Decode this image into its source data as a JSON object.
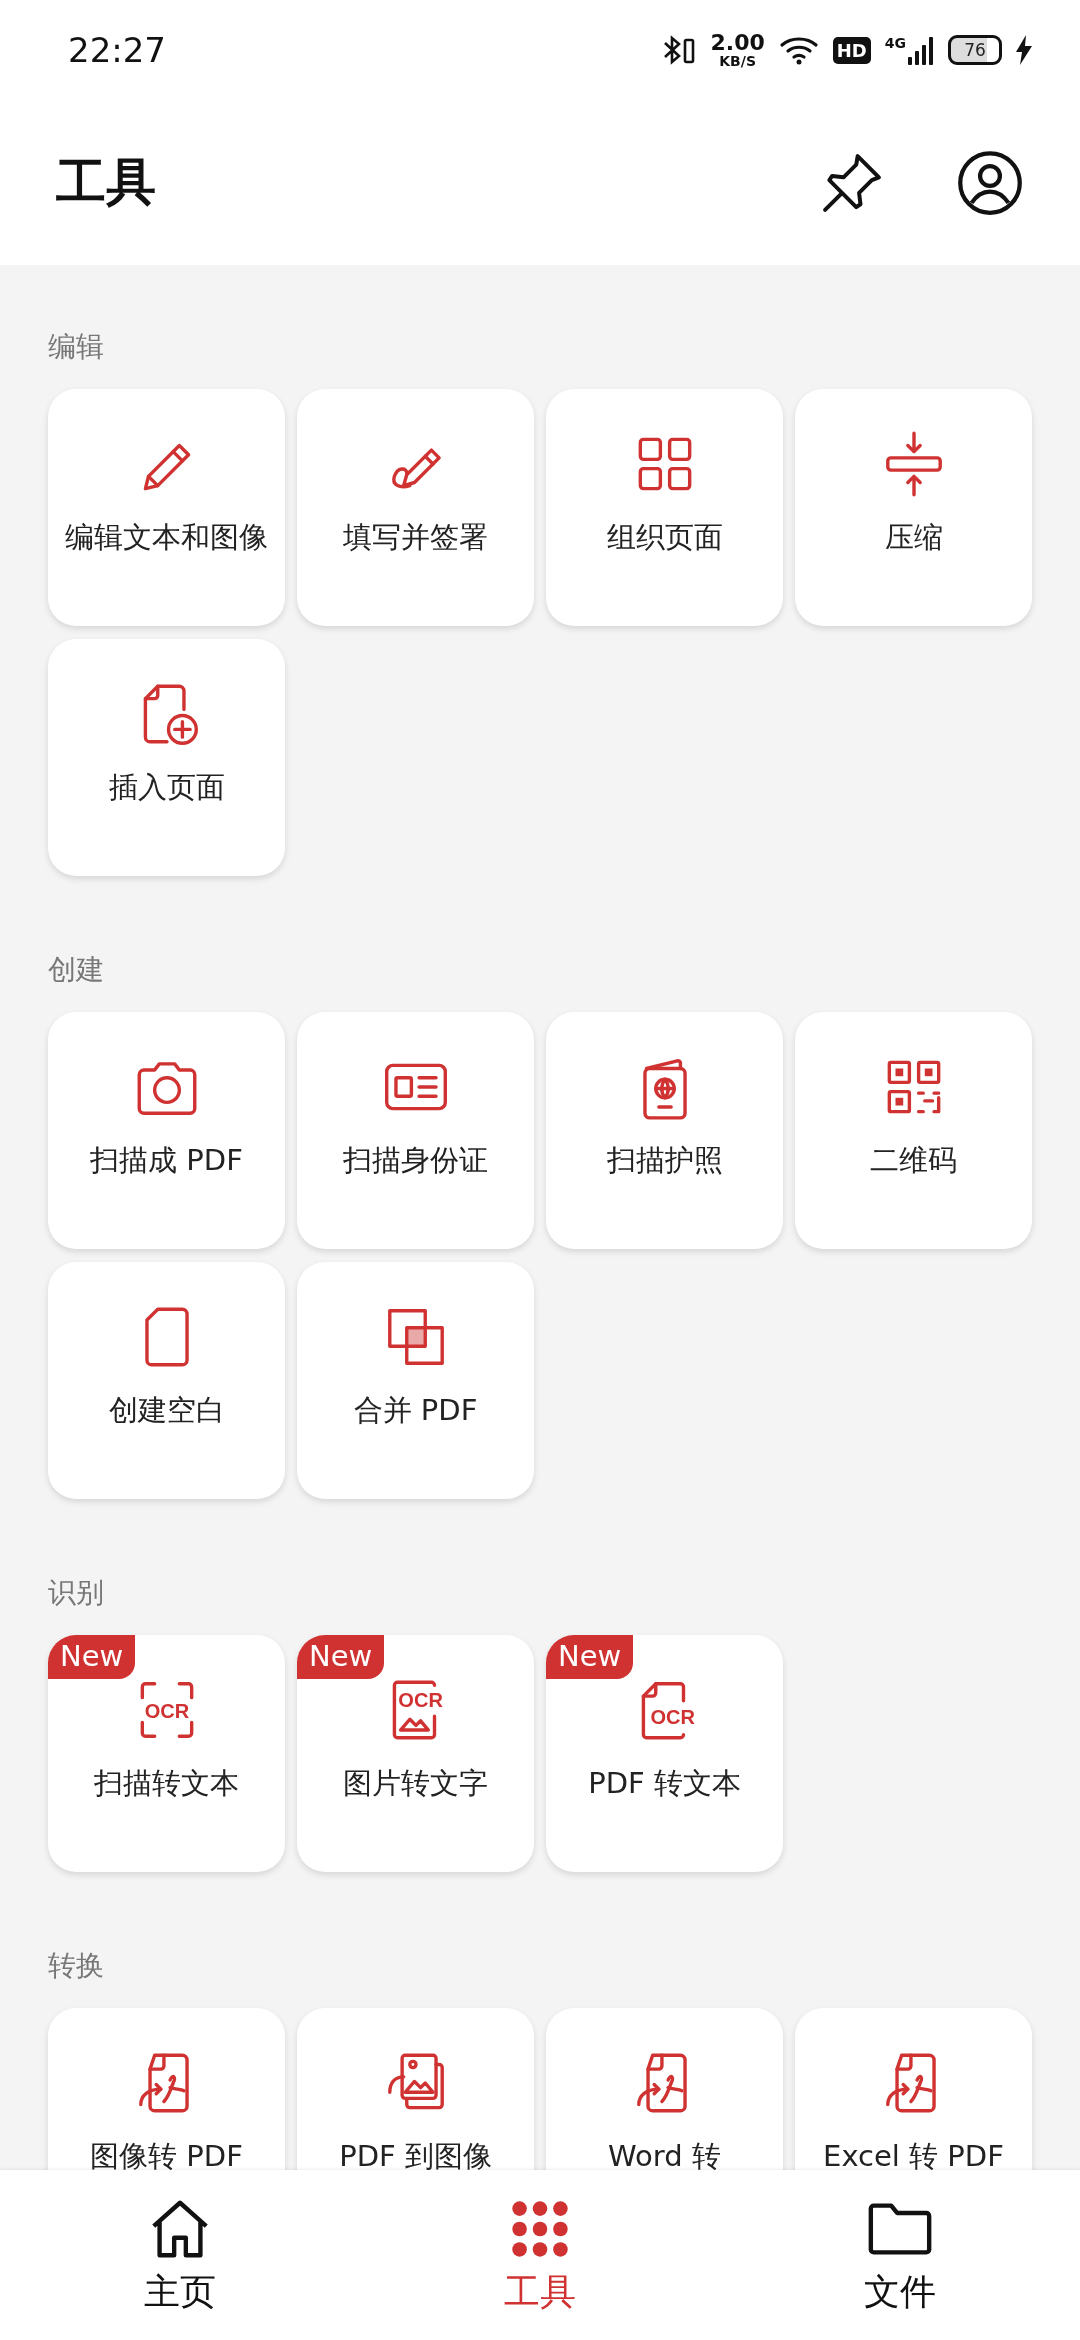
{
  "status_bar": {
    "time": "22:27",
    "speed": "2.00",
    "speed_unit": "KB/S",
    "hd": "HD",
    "network": "4G",
    "battery": "76"
  },
  "header": {
    "title": "工具"
  },
  "sections": [
    {
      "title": "编辑",
      "tools": [
        {
          "label": "编辑文本和图像"
        },
        {
          "label": "填写并签署"
        },
        {
          "label": "组织页面"
        },
        {
          "label": "压缩"
        },
        {
          "label": "插入页面"
        }
      ]
    },
    {
      "title": "创建",
      "tools": [
        {
          "label": "扫描成 PDF"
        },
        {
          "label": "扫描身份证"
        },
        {
          "label": "扫描护照"
        },
        {
          "label": "二维码"
        },
        {
          "label": "创建空白"
        },
        {
          "label": "合并 PDF"
        }
      ]
    },
    {
      "title": "识别",
      "tools": [
        {
          "label": "扫描转文本",
          "badge": "New",
          "icon_text": "OCR"
        },
        {
          "label": "图片转文字",
          "badge": "New",
          "icon_text": "OCR"
        },
        {
          "label": "PDF 转文本",
          "badge": "New",
          "icon_text": "OCR"
        }
      ]
    },
    {
      "title": "转换",
      "tools": [
        {
          "label": "图像转 PDF"
        },
        {
          "label": "PDF 到图像"
        },
        {
          "label": "Word 转"
        },
        {
          "label": "Excel 转 PDF"
        }
      ]
    }
  ],
  "nav": [
    {
      "label": "主页",
      "selected": false
    },
    {
      "label": "工具",
      "selected": true
    },
    {
      "label": "文件",
      "selected": false
    }
  ]
}
